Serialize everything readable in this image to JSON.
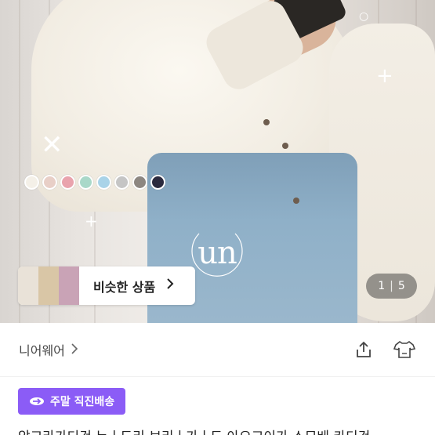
{
  "hero": {
    "swatch_colors": [
      "#f4f0e8",
      "#e8cfc7",
      "#e9a3ad",
      "#a9d8c9",
      "#a9d3e8",
      "#c5c5c5",
      "#8d8781",
      "#2b2a3e"
    ],
    "logo_text": "un"
  },
  "similar": {
    "label": "비슷한 상품",
    "thumb_colors": [
      "#e9e2d8",
      "#d9c6a6",
      "#c9a3b6"
    ]
  },
  "pager": {
    "current": "1",
    "total": "5"
  },
  "seller": {
    "name": "니어웨어"
  },
  "badge": {
    "label": "주말 직진배송",
    "color": "#8b5cf6"
  },
  "product": {
    "title_partial": "앙고라가디건 뉴ㅣ드리 브리ㅣ가ㅣ드 아오고이가 스모베 카디건"
  }
}
